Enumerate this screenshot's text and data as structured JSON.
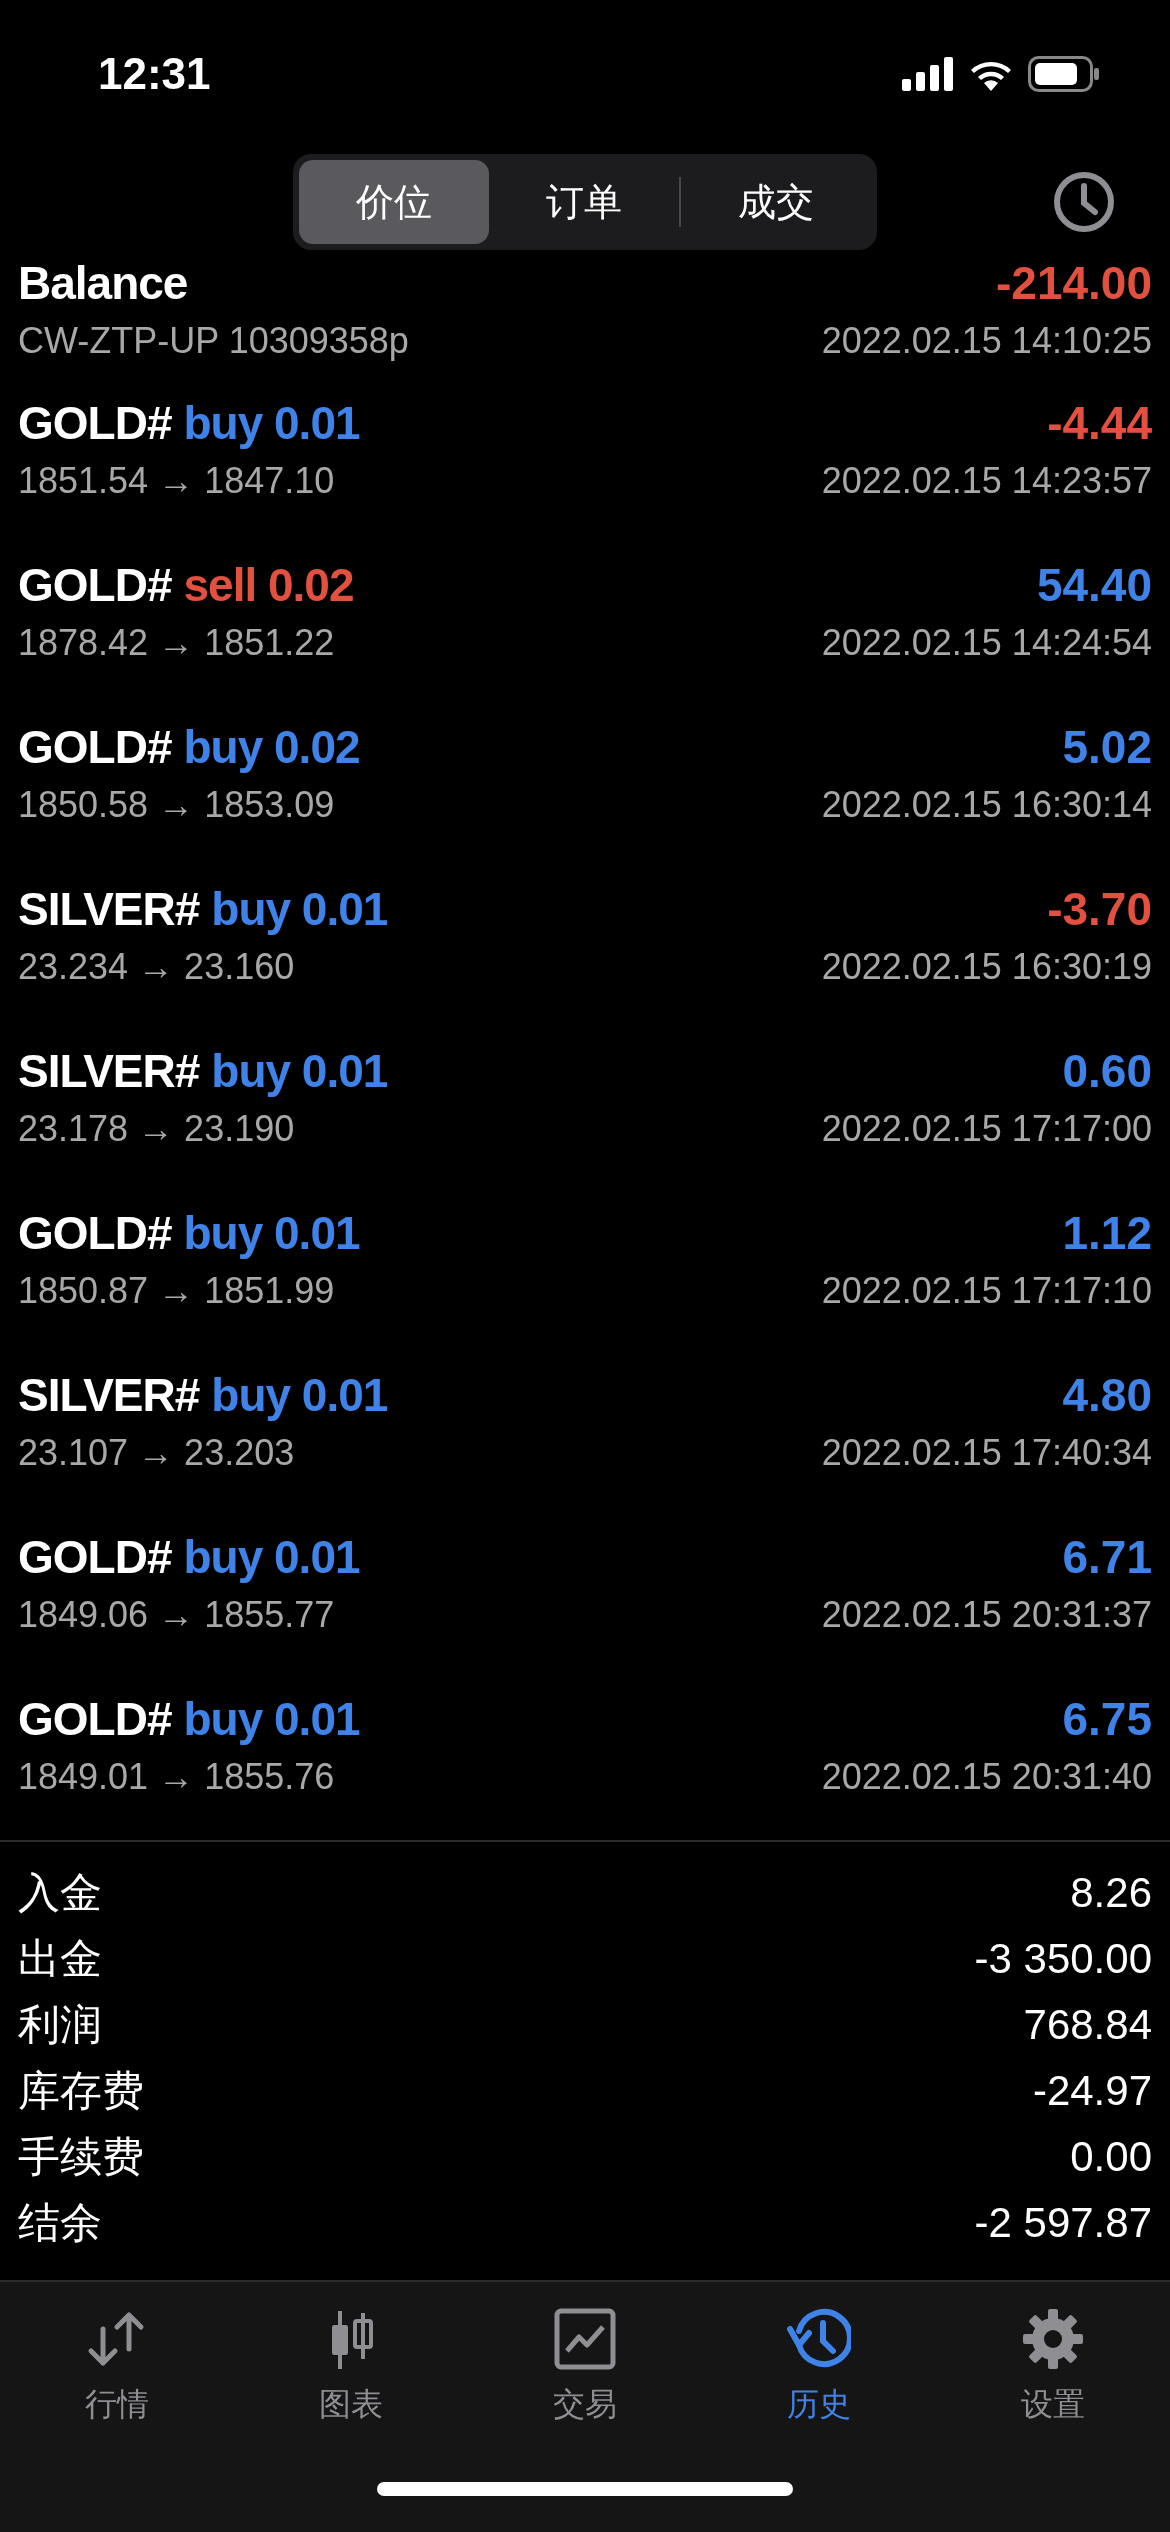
{
  "status_bar": {
    "time": "12:31"
  },
  "segments": [
    {
      "label": "价位",
      "selected": true
    },
    {
      "label": "订单",
      "selected": false
    },
    {
      "label": "成交",
      "selected": false
    }
  ],
  "deals": [
    {
      "kind": "balance",
      "title": "Balance",
      "detail": "CW-ZTP-UP 10309358p",
      "color": "#e2503f",
      "profit": "-214.00",
      "time": "2022.02.15 14:10:25"
    },
    {
      "kind": "buy",
      "title": "GOLD#",
      "volume": "buy 0.01",
      "detail": "1851.54 → 1847.10",
      "color": "#e2503f",
      "profit": "-4.44",
      "time": "2022.02.15 14:23:57"
    },
    {
      "kind": "sell",
      "title": "GOLD#",
      "volume": "sell 0.02",
      "detail": "1878.42 → 1851.22",
      "color": "#3f82e8",
      "profit": "54.40",
      "time": "2022.02.15 14:24:54"
    },
    {
      "kind": "buy",
      "title": "GOLD#",
      "volume": "buy 0.02",
      "detail": "1850.58 → 1853.09",
      "color": "#3f82e8",
      "profit": "5.02",
      "time": "2022.02.15 16:30:14"
    },
    {
      "kind": "buy",
      "title": "SILVER#",
      "volume": "buy 0.01",
      "detail": "23.234 → 23.160",
      "color": "#e2503f",
      "profit": "-3.70",
      "time": "2022.02.15 16:30:19"
    },
    {
      "kind": "buy",
      "title": "SILVER#",
      "volume": "buy 0.01",
      "detail": "23.178 → 23.190",
      "color": "#3f82e8",
      "profit": "0.60",
      "time": "2022.02.15 17:17:00"
    },
    {
      "kind": "buy",
      "title": "GOLD#",
      "volume": "buy 0.01",
      "detail": "1850.87 → 1851.99",
      "color": "#3f82e8",
      "profit": "1.12",
      "time": "2022.02.15 17:17:10"
    },
    {
      "kind": "buy",
      "title": "SILVER#",
      "volume": "buy 0.01",
      "detail": "23.107 → 23.203",
      "color": "#3f82e8",
      "profit": "4.80",
      "time": "2022.02.15 17:40:34"
    },
    {
      "kind": "buy",
      "title": "GOLD#",
      "volume": "buy 0.01",
      "detail": "1849.06 → 1855.77",
      "color": "#3f82e8",
      "profit": "6.71",
      "time": "2022.02.15 20:31:37"
    },
    {
      "kind": "buy",
      "title": "GOLD#",
      "volume": "buy 0.01",
      "detail": "1849.01 → 1855.76",
      "color": "#3f82e8",
      "profit": "6.75",
      "time": "2022.02.15 20:31:40"
    }
  ],
  "summary": [
    {
      "label": "入金",
      "value": "8.26"
    },
    {
      "label": "出金",
      "value": "-3 350.00"
    },
    {
      "label": "利润",
      "value": "768.84"
    },
    {
      "label": "库存费",
      "value": "-24.97"
    },
    {
      "label": "手续费",
      "value": "0.00"
    },
    {
      "label": "结余",
      "value": "-2 597.87"
    }
  ],
  "nav": [
    {
      "label": "行情",
      "selected": false
    },
    {
      "label": "图表",
      "selected": false
    },
    {
      "label": "交易",
      "selected": false
    },
    {
      "label": "历史",
      "selected": true
    },
    {
      "label": "设置",
      "selected": false
    }
  ]
}
